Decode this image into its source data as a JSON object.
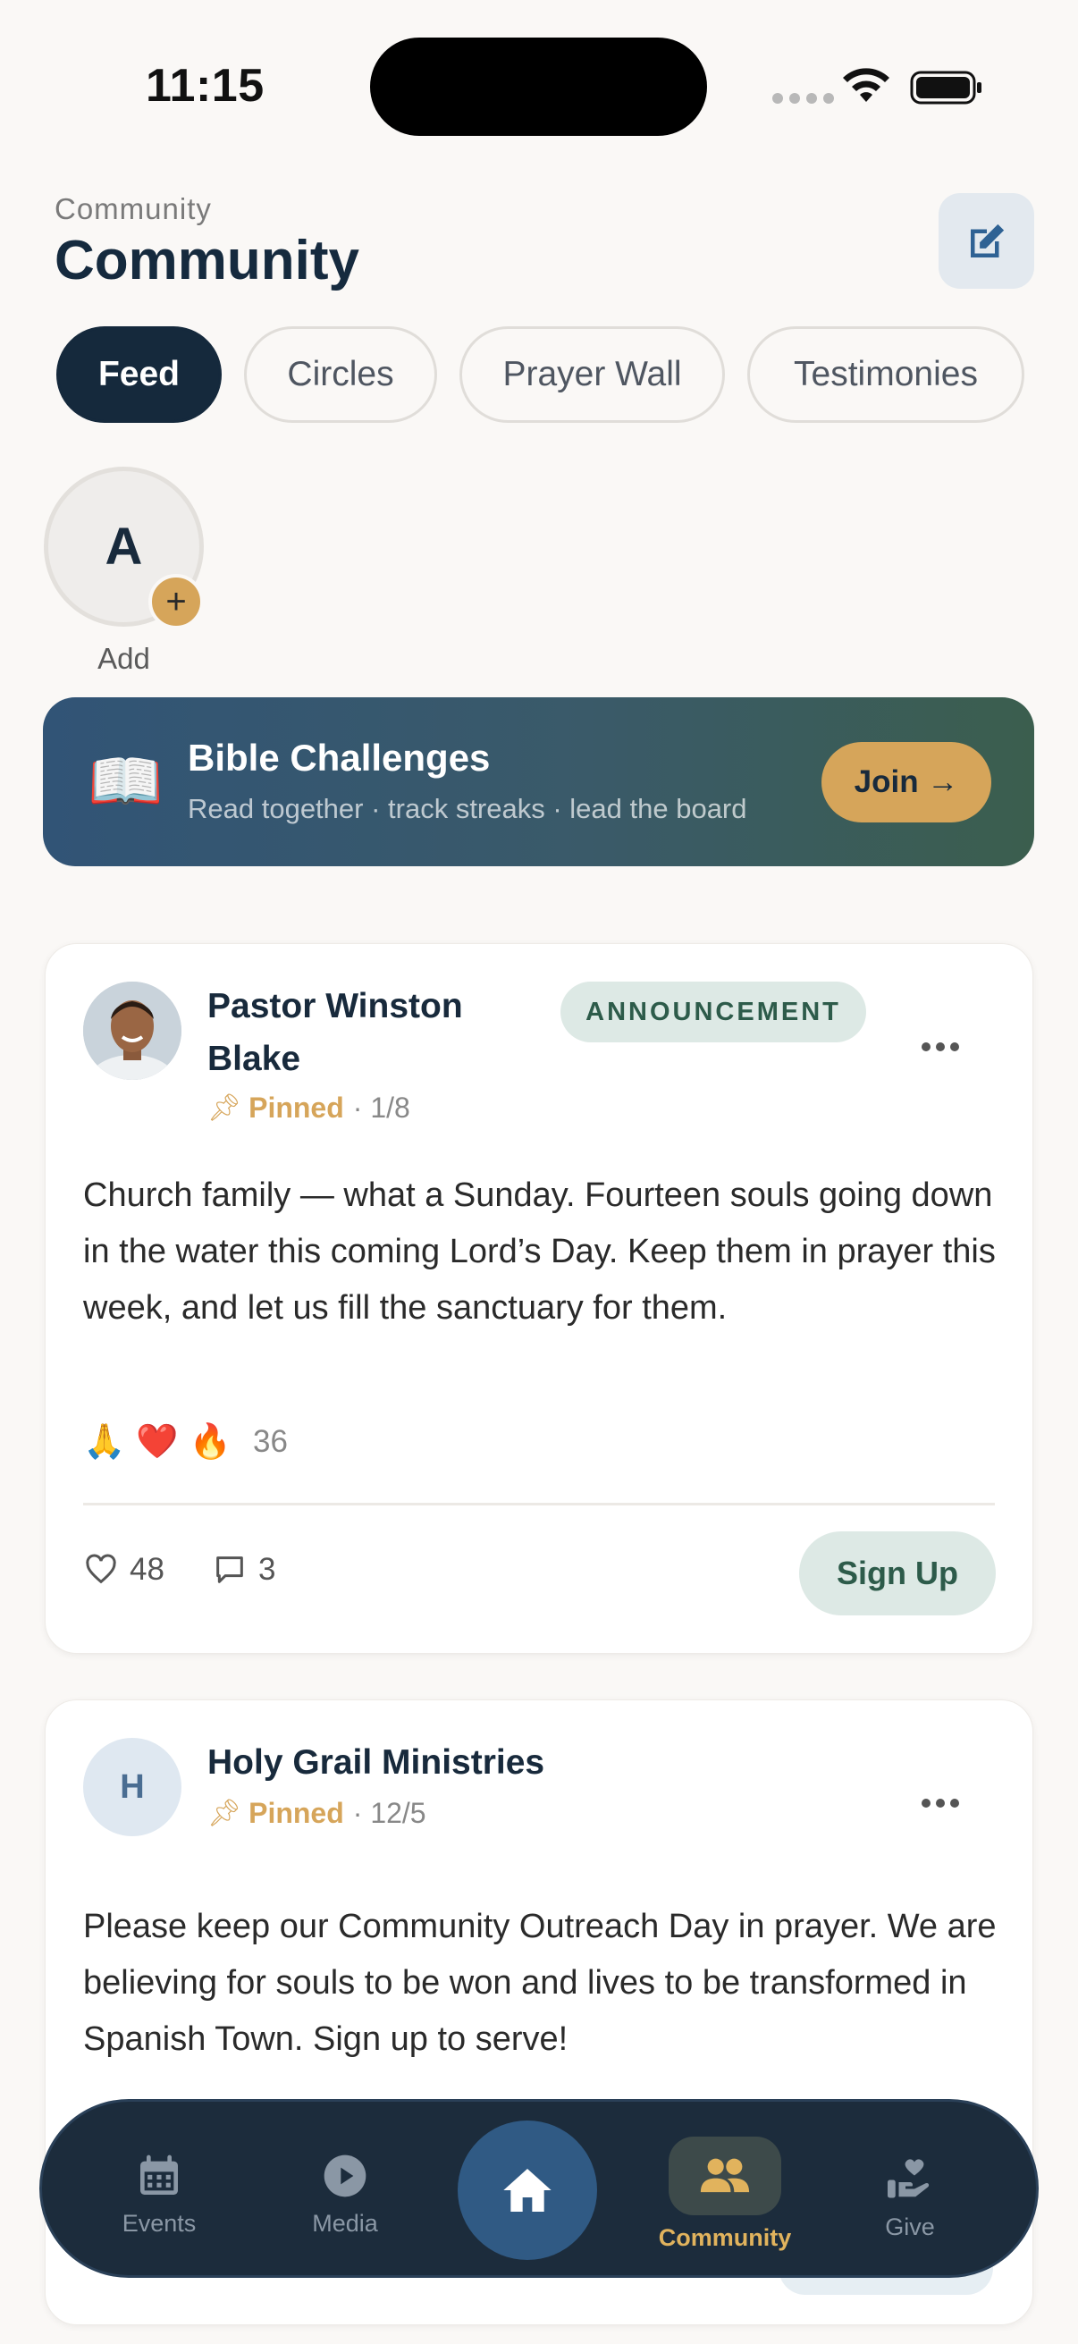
{
  "status_bar": {
    "time": "11:15"
  },
  "header": {
    "subtitle": "Community",
    "title": "Community"
  },
  "tabs": [
    {
      "label": "Feed",
      "active": true
    },
    {
      "label": "Circles",
      "active": false
    },
    {
      "label": "Prayer Wall",
      "active": false
    },
    {
      "label": "Testimonies",
      "active": false
    }
  ],
  "story": {
    "initial": "A",
    "label": "Add"
  },
  "banner": {
    "icon": "open-book-emoji",
    "title": "Bible Challenges",
    "subtitle": "Read together · track streaks · lead the board",
    "button": "Join →"
  },
  "posts": [
    {
      "author": "Pastor Winston Blake",
      "author_line1": "Pastor Winston",
      "author_line2": "Blake",
      "badge": "ANNOUNCEMENT",
      "pinned": "Pinned",
      "date": "· 1/8",
      "body": "Church family — what a Sunday. Fourteen souls going down in the water this coming Lord’s Day. Keep them in prayer this week, and let us fill the sanctuary for them.",
      "reactions": {
        "emojis": [
          "🙏",
          "❤️",
          "🔥"
        ],
        "count": "36"
      },
      "likes": "48",
      "comments": "3",
      "cta": "Sign Up"
    },
    {
      "author": "Holy Grail Ministries",
      "initial": "H",
      "pinned": "Pinned",
      "date": "· 12/5",
      "body": "Please keep our Community Outreach Day in prayer. We are believing for souls to be won and lives to be transformed in Spanish Town. Sign up to serve!"
    }
  ],
  "bottom_nav": [
    {
      "label": "Events",
      "icon": "calendar-icon",
      "active": false
    },
    {
      "label": "Media",
      "icon": "play-icon",
      "active": false
    },
    {
      "label": "",
      "icon": "home-icon",
      "active": false
    },
    {
      "label": "Community",
      "icon": "people-icon",
      "active": true
    },
    {
      "label": "Give",
      "icon": "give-hand-heart-icon",
      "active": false
    }
  ],
  "colors": {
    "background": "#faf8f6",
    "navy": "#15293c",
    "gold": "#d6a55a",
    "mint": "#dde9e5",
    "nav_bg": "#1c2c3c"
  }
}
